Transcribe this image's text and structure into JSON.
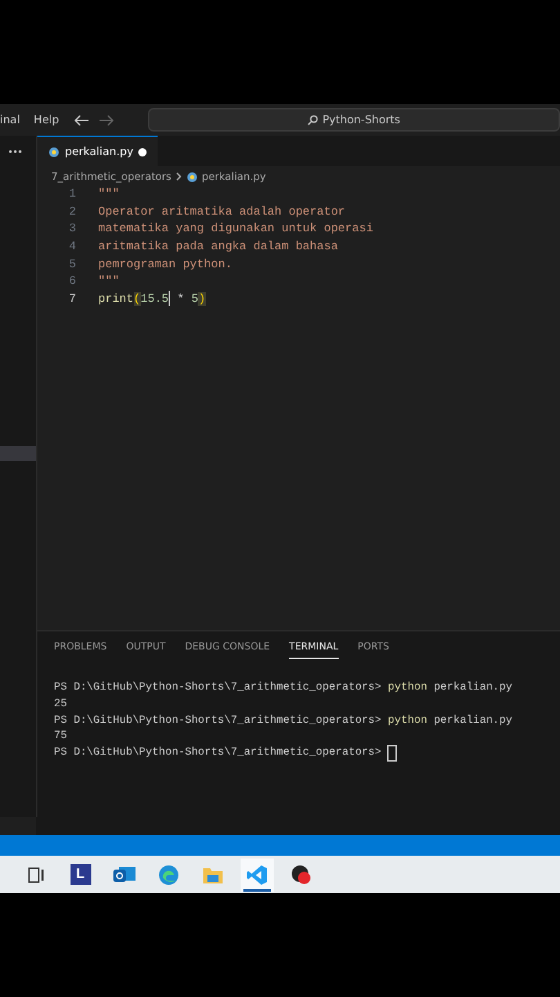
{
  "menu": [
    "inal",
    "Help"
  ],
  "command_center": {
    "text": "Python-Shorts"
  },
  "tabs": [
    {
      "label": "perkalian.py",
      "selected": true,
      "modified": true
    }
  ],
  "breadcrumb": [
    "7_arithmetic_operators",
    "perkalian.py"
  ],
  "code_lines": [
    {
      "number": "1",
      "current": false,
      "tokens": [
        {
          "kind": "string",
          "text": "\"\"\""
        }
      ]
    },
    {
      "number": "2",
      "current": false,
      "tokens": [
        {
          "kind": "string",
          "text": "Operator aritmatika adalah operator"
        }
      ]
    },
    {
      "number": "3",
      "current": false,
      "tokens": [
        {
          "kind": "string",
          "text": "matematika yang digunakan untuk operasi"
        }
      ]
    },
    {
      "number": "4",
      "current": false,
      "tokens": [
        {
          "kind": "string",
          "text": "aritmatika pada angka dalam bahasa"
        }
      ]
    },
    {
      "number": "5",
      "current": false,
      "tokens": [
        {
          "kind": "string",
          "text": "pemrograman python."
        }
      ]
    },
    {
      "number": "6",
      "current": false,
      "tokens": [
        {
          "kind": "string",
          "text": "\"\"\""
        }
      ]
    },
    {
      "number": "7",
      "current": true,
      "tokens": [
        {
          "kind": "function",
          "text": "print"
        },
        {
          "kind": "bracket",
          "text": "("
        },
        {
          "kind": "number",
          "text": "15.5"
        },
        {
          "kind": "cursor"
        },
        {
          "kind": "plain",
          "text": " * "
        },
        {
          "kind": "number",
          "text": "5"
        },
        {
          "kind": "bracket",
          "text": ")"
        }
      ]
    }
  ],
  "panel_tabs": [
    {
      "label": "PROBLEMS",
      "selected": false
    },
    {
      "label": "OUTPUT",
      "selected": false
    },
    {
      "label": "DEBUG CONSOLE",
      "selected": false
    },
    {
      "label": "TERMINAL",
      "selected": true
    },
    {
      "label": "PORTS",
      "selected": false
    }
  ],
  "terminal_lines": [
    {
      "kind": "prompt",
      "prompt": "PS D:\\GitHub\\Python-Shorts\\7_arithmetic_operators>",
      "command": "python",
      "args": "perkalian.py"
    },
    {
      "kind": "output",
      "text": "25"
    },
    {
      "kind": "prompt",
      "prompt": "PS D:\\GitHub\\Python-Shorts\\7_arithmetic_operators>",
      "command": "python",
      "args": "perkalian.py"
    },
    {
      "kind": "output",
      "text": "75"
    },
    {
      "kind": "prompt",
      "prompt": "PS D:\\GitHub\\Python-Shorts\\7_arithmetic_operators>",
      "cursor": true
    }
  ],
  "taskbar": [
    {
      "kind": "task-view",
      "selected": false
    },
    {
      "kind": "letter",
      "label": "L",
      "selected": false
    },
    {
      "kind": "mail",
      "selected": false
    },
    {
      "kind": "browser",
      "selected": false
    },
    {
      "kind": "folder",
      "selected": false
    },
    {
      "kind": "code",
      "selected": true
    },
    {
      "kind": "recorder",
      "selected": false
    }
  ]
}
